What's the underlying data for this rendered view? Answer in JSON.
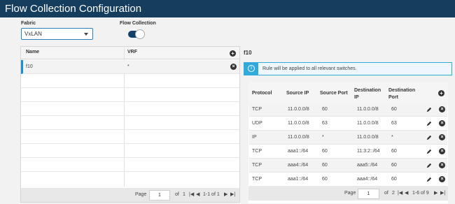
{
  "header": {
    "title": "Flow Collection Configuration"
  },
  "controls": {
    "fabric_label": "Fabric",
    "fabric_value": "VxLAN",
    "flow_collection_label": "Flow Collection",
    "flow_collection_enabled": true
  },
  "left_table": {
    "columns": [
      "Name",
      "VRF"
    ],
    "rows": [
      {
        "name": "f10",
        "vrf": "*"
      }
    ],
    "pager": {
      "page_label": "Page",
      "page_value": "1",
      "of_label": "of",
      "total_pages": "1",
      "range": "1-1 of 1"
    }
  },
  "right_panel": {
    "title": "f10",
    "info_text": "Rule will be applied to all relevant switches.",
    "columns": [
      "Protocol",
      "Source IP",
      "Source Port",
      "Destination IP",
      "Destination Port"
    ],
    "rows": [
      {
        "protocol": "TCP",
        "source_ip": "11.0.0.0/8",
        "source_port": "60",
        "destination_ip": "11.0.0.0/8",
        "destination_port": "60"
      },
      {
        "protocol": "UDP",
        "source_ip": "11.0.0.0/8",
        "source_port": "63",
        "destination_ip": "11.0.0.0/8",
        "destination_port": "63"
      },
      {
        "protocol": "IP",
        "source_ip": "11.0.0.0/8",
        "source_port": "*",
        "destination_ip": "11.0.0.0/8",
        "destination_port": "*"
      },
      {
        "protocol": "TCP",
        "source_ip": "aaa1::/64",
        "source_port": "60",
        "destination_ip": "11:3:2::/64",
        "destination_port": "60"
      },
      {
        "protocol": "TCP",
        "source_ip": "aaa4::/64",
        "source_port": "60",
        "destination_ip": "aaa5::/64",
        "destination_port": "60"
      },
      {
        "protocol": "TCP",
        "source_ip": "aaa1::/64",
        "source_port": "60",
        "destination_ip": "aaa4::/64",
        "destination_port": "60"
      }
    ],
    "pager": {
      "page_label": "Page",
      "page_value": "1",
      "of_label": "of",
      "total_pages": "2",
      "range": "1-6 of 9"
    }
  },
  "nav_glyphs": {
    "first": "|◀",
    "prev": "◀",
    "next": "▶",
    "last": "▶|"
  },
  "icons": {
    "add": "+",
    "delete": "×"
  },
  "colors": {
    "titlebar": "#143d5e",
    "accent": "#2d7fb8",
    "info": "#30a9db"
  }
}
